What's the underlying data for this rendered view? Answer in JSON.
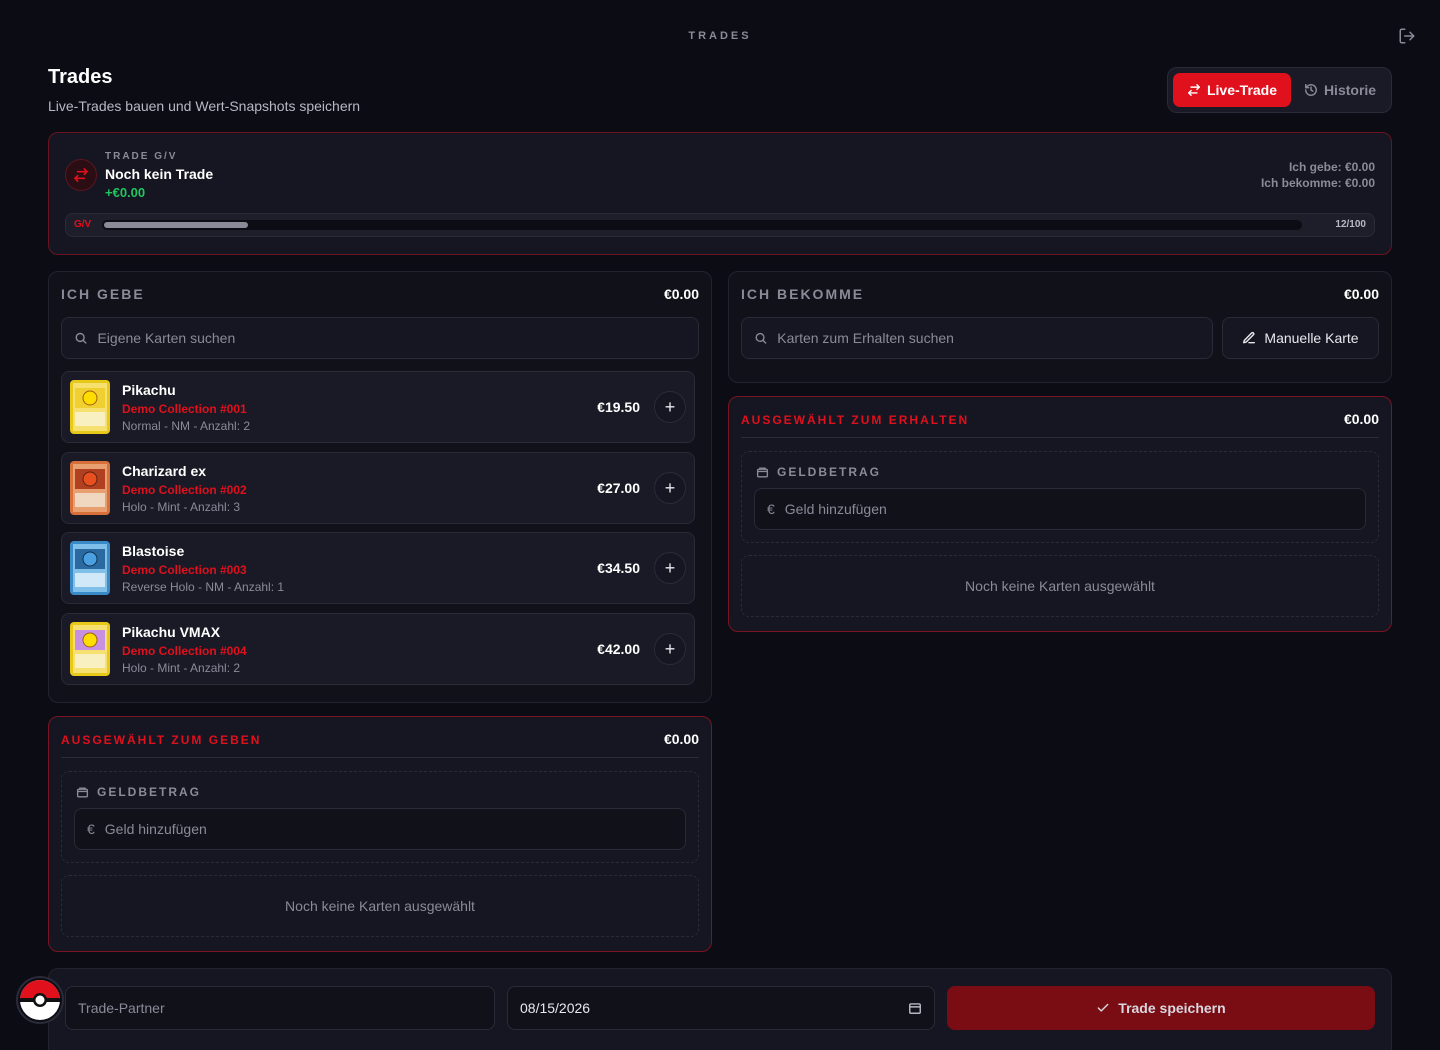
{
  "header": {
    "kicker": "TRADES",
    "title": "Trades",
    "subtitle": "Live-Trades bauen und Wert-Snapshots speichern"
  },
  "tabs": {
    "live": "Live-Trade",
    "history": "Historie"
  },
  "gv": {
    "kicker": "TRADE G/V",
    "title": "Noch kein Trade",
    "value": "+€0.00",
    "give_summary": "Ich gebe: €0.00",
    "get_summary": "Ich bekomme: €0.00",
    "bar_label": "G/V",
    "bar_count": "12/100",
    "bar_fill": 0.12
  },
  "give": {
    "heading": "ICH GEBE",
    "total": "€0.00",
    "search_placeholder": "Eigene Karten suchen",
    "cards": [
      {
        "name": "Pikachu",
        "collection": "Demo Collection #001",
        "meta": "Normal - NM - Anzahl: 2",
        "price": "€19.50"
      },
      {
        "name": "Charizard ex",
        "collection": "Demo Collection #002",
        "meta": "Holo - Mint - Anzahl: 3",
        "price": "€27.00"
      },
      {
        "name": "Blastoise",
        "collection": "Demo Collection #003",
        "meta": "Reverse Holo - NM - Anzahl: 1",
        "price": "€34.50"
      },
      {
        "name": "Pikachu VMAX",
        "collection": "Demo Collection #004",
        "meta": "Holo - Mint - Anzahl: 2",
        "price": "€42.00"
      }
    ]
  },
  "get": {
    "heading": "ICH BEKOMME",
    "total": "€0.00",
    "search_placeholder": "Karten zum Erhalten suchen",
    "manual_label": "Manuelle Karte"
  },
  "selected_give": {
    "heading": "AUSGEWÄHLT ZUM GEBEN",
    "total": "€0.00",
    "money_label": "GELDBETRAG",
    "money_placeholder": "Geld hinzufügen",
    "currency": "€",
    "empty": "Noch keine Karten ausgewählt"
  },
  "selected_get": {
    "heading": "AUSGEWÄHLT ZUM ERHALTEN",
    "total": "€0.00",
    "money_label": "GELDBETRAG",
    "money_placeholder": "Geld hinzufügen",
    "currency": "€",
    "empty": "Noch keine Karten ausgewählt"
  },
  "footer": {
    "partner_placeholder": "Trade-Partner",
    "date_value": "08/15/2026",
    "save_label": "Trade speichern"
  },
  "colors": {
    "accent": "#e0101c",
    "positive": "#22c55e",
    "background": "#0c0c14"
  }
}
